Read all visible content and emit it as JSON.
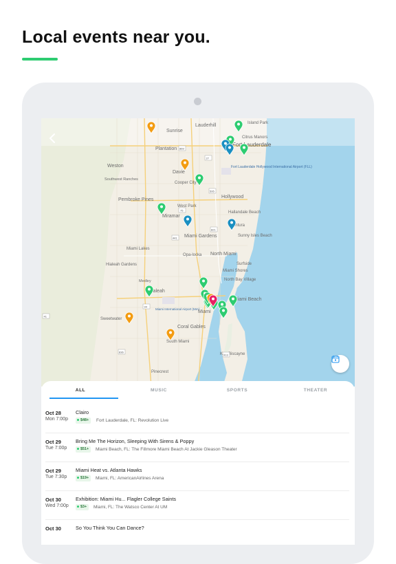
{
  "headline": "Local events near you.",
  "colors": {
    "accent": "#2ecc71",
    "tab_active": "#2196f3",
    "pin_green": "#2ecc71",
    "pin_orange": "#f39c12",
    "pin_teal": "#1a8fc1",
    "pin_pink": "#e91e63",
    "water": "#a3d4ec",
    "land": "#f3efe6"
  },
  "map": {
    "places": [
      {
        "name": "Lauderhill"
      },
      {
        "name": "Sunrise"
      },
      {
        "name": "Island Park"
      },
      {
        "name": "Citrus Manors"
      },
      {
        "name": "Fort Lauderdale"
      },
      {
        "name": "Plantation"
      },
      {
        "name": "Weston"
      },
      {
        "name": "Davie"
      },
      {
        "name": "Southwest Ranches"
      },
      {
        "name": "Cooper City"
      },
      {
        "name": "Fort Lauderdale Hollywood International Airport (FLL)"
      },
      {
        "name": "Pembroke Pines"
      },
      {
        "name": "West Park"
      },
      {
        "name": "Hollywood"
      },
      {
        "name": "Hallandale Beach"
      },
      {
        "name": "Miramar"
      },
      {
        "name": "Aventura"
      },
      {
        "name": "Sunny Isles Beach"
      },
      {
        "name": "Miami Gardens"
      },
      {
        "name": "Miami Lakes"
      },
      {
        "name": "Opa-locka"
      },
      {
        "name": "North Miami"
      },
      {
        "name": "Surfside"
      },
      {
        "name": "Hialeah Gardens"
      },
      {
        "name": "Miami Shores"
      },
      {
        "name": "Medley"
      },
      {
        "name": "North Bay Village"
      },
      {
        "name": "Hialeah"
      },
      {
        "name": "Miami Beach"
      },
      {
        "name": "Miami International Airport (MIA)"
      },
      {
        "name": "Miami"
      },
      {
        "name": "Sweetwater"
      },
      {
        "name": "Coral Gables"
      },
      {
        "name": "South Miami"
      },
      {
        "name": "Key Biscayne"
      },
      {
        "name": "Pinecrest"
      }
    ],
    "highway_shields": [
      "27",
      "821",
      "595",
      "75",
      "441",
      "869",
      "836",
      "94",
      "41",
      "913"
    ],
    "pins": [
      {
        "category": "concert",
        "color": "green"
      },
      {
        "category": "concert",
        "color": "green"
      },
      {
        "category": "concert",
        "color": "green"
      },
      {
        "category": "concert",
        "color": "green"
      },
      {
        "category": "concert",
        "color": "green"
      },
      {
        "category": "concert",
        "color": "green"
      },
      {
        "category": "concert",
        "color": "green"
      },
      {
        "category": "concert",
        "color": "green"
      },
      {
        "category": "concert",
        "color": "green"
      },
      {
        "category": "concert",
        "color": "green"
      },
      {
        "category": "concert",
        "color": "green"
      },
      {
        "category": "concert",
        "color": "green"
      },
      {
        "category": "concert",
        "color": "green"
      },
      {
        "category": "concert",
        "color": "green"
      },
      {
        "category": "concert",
        "color": "green"
      },
      {
        "category": "sports",
        "color": "orange"
      },
      {
        "category": "sports",
        "color": "orange"
      },
      {
        "category": "sports",
        "color": "orange"
      },
      {
        "category": "sports",
        "color": "orange"
      },
      {
        "category": "sports",
        "color": "orange"
      },
      {
        "category": "theater",
        "color": "teal"
      },
      {
        "category": "theater",
        "color": "teal"
      },
      {
        "category": "theater",
        "color": "teal"
      },
      {
        "category": "theater",
        "color": "teal"
      },
      {
        "category": "selected",
        "color": "pink"
      }
    ],
    "back_icon": "chevron-left-icon",
    "calendar_icon": "calendar-icon"
  },
  "tabs": [
    {
      "label": "ALL",
      "active": true
    },
    {
      "label": "MUSIC",
      "active": false
    },
    {
      "label": "SPORTS",
      "active": false
    },
    {
      "label": "THEATER",
      "active": false
    }
  ],
  "events": [
    {
      "date": "Oct 28",
      "time": "Mon 7:00p",
      "title": "Clairo",
      "price": "$48+",
      "venue": "Fort Lauderdale, FL: Revolution Live"
    },
    {
      "date": "Oct 29",
      "time": "Tue 7:00p",
      "title": "Bring Me The Horizon, Sleeping With Sirens & Poppy",
      "price": "$51+",
      "venue": "Miami Beach, FL: The Fillmore Miami Beach At Jackie Gleason Theater"
    },
    {
      "date": "Oct 29",
      "time": "Tue 7:30p",
      "title": "Miami Heat vs. Atlanta Hawks",
      "price": "$19+",
      "venue": "Miami, FL: AmericanAirlines Arena"
    },
    {
      "date": "Oct 30",
      "time": "Wed 7:00p",
      "title": "Exhibition: Miami Hu... Flagler College Saints",
      "price": "$3+",
      "venue": "Miami, FL: The Watsco Center At UM"
    },
    {
      "date": "Oct 30",
      "time": "",
      "title": "So You Think You Can Dance?",
      "price": "",
      "venue": ""
    }
  ]
}
